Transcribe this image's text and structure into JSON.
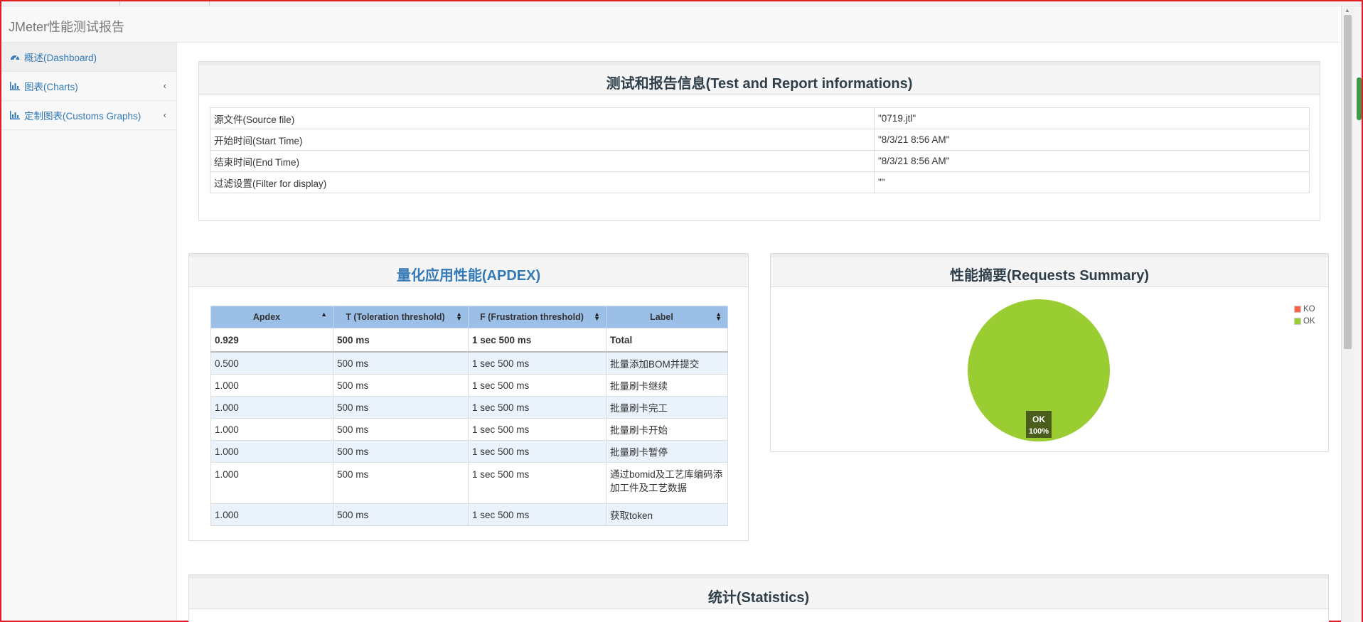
{
  "app": {
    "title": "JMeter性能测试报告"
  },
  "sidebar": {
    "items": [
      {
        "label": "概述(Dashboard)",
        "icon": "dashboard-icon",
        "active": true
      },
      {
        "label": "图表(Charts)",
        "icon": "bar-chart-icon"
      },
      {
        "label": "定制图表(Customs Graphs)",
        "icon": "bar-chart-icon"
      }
    ]
  },
  "test_info": {
    "title": "测试和报告信息(Test and Report informations)",
    "rows": [
      {
        "key": "源文件(Source file)",
        "value": "\"0719.jtl\""
      },
      {
        "key": "开始时间(Start Time)",
        "value": "\"8/3/21 8:56 AM\""
      },
      {
        "key": "结束时间(End Time)",
        "value": "\"8/3/21 8:56 AM\""
      },
      {
        "key": "过滤设置(Filter for display)",
        "value": "\"\""
      }
    ]
  },
  "apdex": {
    "title": "量化应用性能(APDEX)",
    "headers": [
      "Apdex",
      "T (Toleration threshold)",
      "F (Frustration threshold)",
      "Label"
    ],
    "total": [
      "0.929",
      "500 ms",
      "1 sec 500 ms",
      "Total"
    ],
    "rows": [
      [
        "0.500",
        "500 ms",
        "1 sec 500 ms",
        "批量添加BOM并提交"
      ],
      [
        "1.000",
        "500 ms",
        "1 sec 500 ms",
        "批量刷卡继续"
      ],
      [
        "1.000",
        "500 ms",
        "1 sec 500 ms",
        "批量刷卡完工"
      ],
      [
        "1.000",
        "500 ms",
        "1 sec 500 ms",
        "批量刷卡开始"
      ],
      [
        "1.000",
        "500 ms",
        "1 sec 500 ms",
        "批量刷卡暂停"
      ],
      [
        "1.000",
        "500 ms",
        "1 sec 500 ms",
        "通过bomid及工艺库编码添加工件及工艺数据"
      ],
      [
        "1.000",
        "500 ms",
        "1 sec 500 ms",
        "获取token"
      ]
    ]
  },
  "summary": {
    "title": "性能摘要(Requests Summary)",
    "colors": {
      "ko": "#ff6347",
      "ok": "#9acd32"
    }
  },
  "statistics": {
    "title": "统计(Statistics)"
  },
  "chart_data": {
    "type": "pie",
    "labels": [
      "KO",
      "OK"
    ],
    "values": [
      0,
      100
    ],
    "colors": [
      "#ff6347",
      "#9acd32"
    ],
    "data_label": {
      "name": "OK",
      "value": "100%"
    },
    "legend_position": "top-right"
  }
}
